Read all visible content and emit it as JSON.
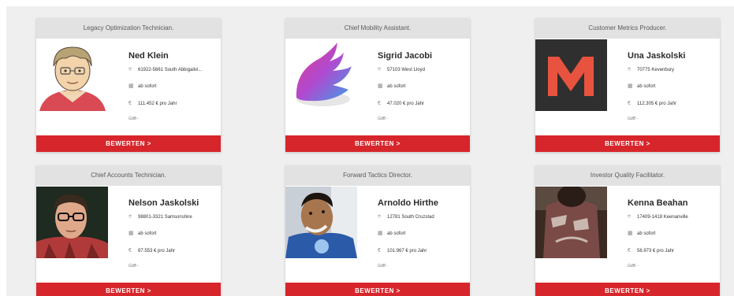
{
  "cards": [
    {
      "title": "Legacy Optimization Technician.",
      "name": "Ned Klein",
      "location": "61922-5661 South Abbigailvi...",
      "availability": "ab sofort",
      "salary": "111.452 € pro Jahr",
      "footnote": "GdB -",
      "button": "BEWERTEN >"
    },
    {
      "title": "Chief Mobility Assistant.",
      "name": "Sigrid Jacobi",
      "location": "57103 West Lloyd",
      "availability": "ab sofort",
      "salary": "47.020 € pro Jahr",
      "footnote": "GdB -",
      "button": "BEWERTEN >"
    },
    {
      "title": "Customer Metrics Producer.",
      "name": "Una Jaskolski",
      "location": "70775 Kevenbury",
      "availability": "ab sofort",
      "salary": "112.305 € pro Jahr",
      "footnote": "GdB -",
      "button": "BEWERTEN >"
    },
    {
      "title": "Chief Accounts Technician.",
      "name": "Nelson Jaskolski",
      "location": "98801-3321 Samsonshire",
      "availability": "ab sofort",
      "salary": "87.553 € pro Jahr",
      "footnote": "GdB -",
      "button": "BEWERTEN >"
    },
    {
      "title": "Forward Tactics Director.",
      "name": "Arnoldo Hirthe",
      "location": "12781 South Cruzstad",
      "availability": "ab sofort",
      "salary": "101.967 € pro Jahr",
      "footnote": "GdB -",
      "button": "BEWERTEN >"
    },
    {
      "title": "Investor Quality Facilitator.",
      "name": "Kenna Beahan",
      "location": "17409-1418 Keenanville",
      "availability": "ab sofort",
      "salary": "56.973 € pro Jahr",
      "footnote": "GdB -",
      "button": "BEWERTEN >"
    }
  ],
  "icons": {
    "location": "map-pin-icon",
    "availability": "calendar-icon",
    "salary": "euro-icon"
  },
  "colors": {
    "accent": "#d7262b",
    "header_bg": "#e2e2e2",
    "page_bg": "#efefef"
  }
}
